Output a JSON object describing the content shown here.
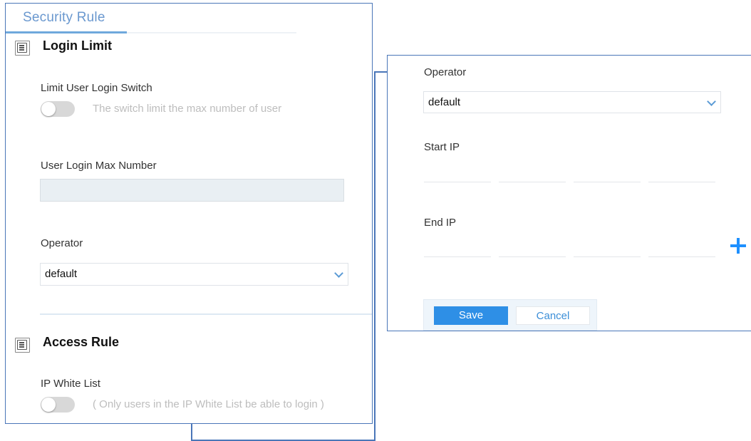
{
  "security_panel": {
    "tab_title": "Security Rule",
    "login_limit": {
      "section_title": "Login Limit",
      "switch_label": "Limit User Login Switch",
      "switch_on": false,
      "switch_hint": "The switch limit the max number of user",
      "max_number_label": "User Login Max Number",
      "max_number_value": "",
      "operator_label": "Operator",
      "operator_value": "default"
    },
    "access_rule": {
      "section_title": "Access Rule",
      "whitelist_label": "IP White List",
      "whitelist_on": false,
      "whitelist_hint": "( Only users in the IP White List be able to login )"
    }
  },
  "whitelist_form": {
    "operator_label": "Operator",
    "operator_value": "default",
    "start_ip_label": "Start IP",
    "end_ip_label": "End IP",
    "save_label": "Save",
    "cancel_label": "Cancel"
  },
  "icons": {
    "section": "document-icon",
    "dropdown": "chevron-down-icon",
    "add": "plus-icon",
    "connector": "arrow-right-icon"
  },
  "colors": {
    "accent": "#2e8fe6",
    "border": "#4a76b8",
    "tab_title": "#6a98cf"
  }
}
